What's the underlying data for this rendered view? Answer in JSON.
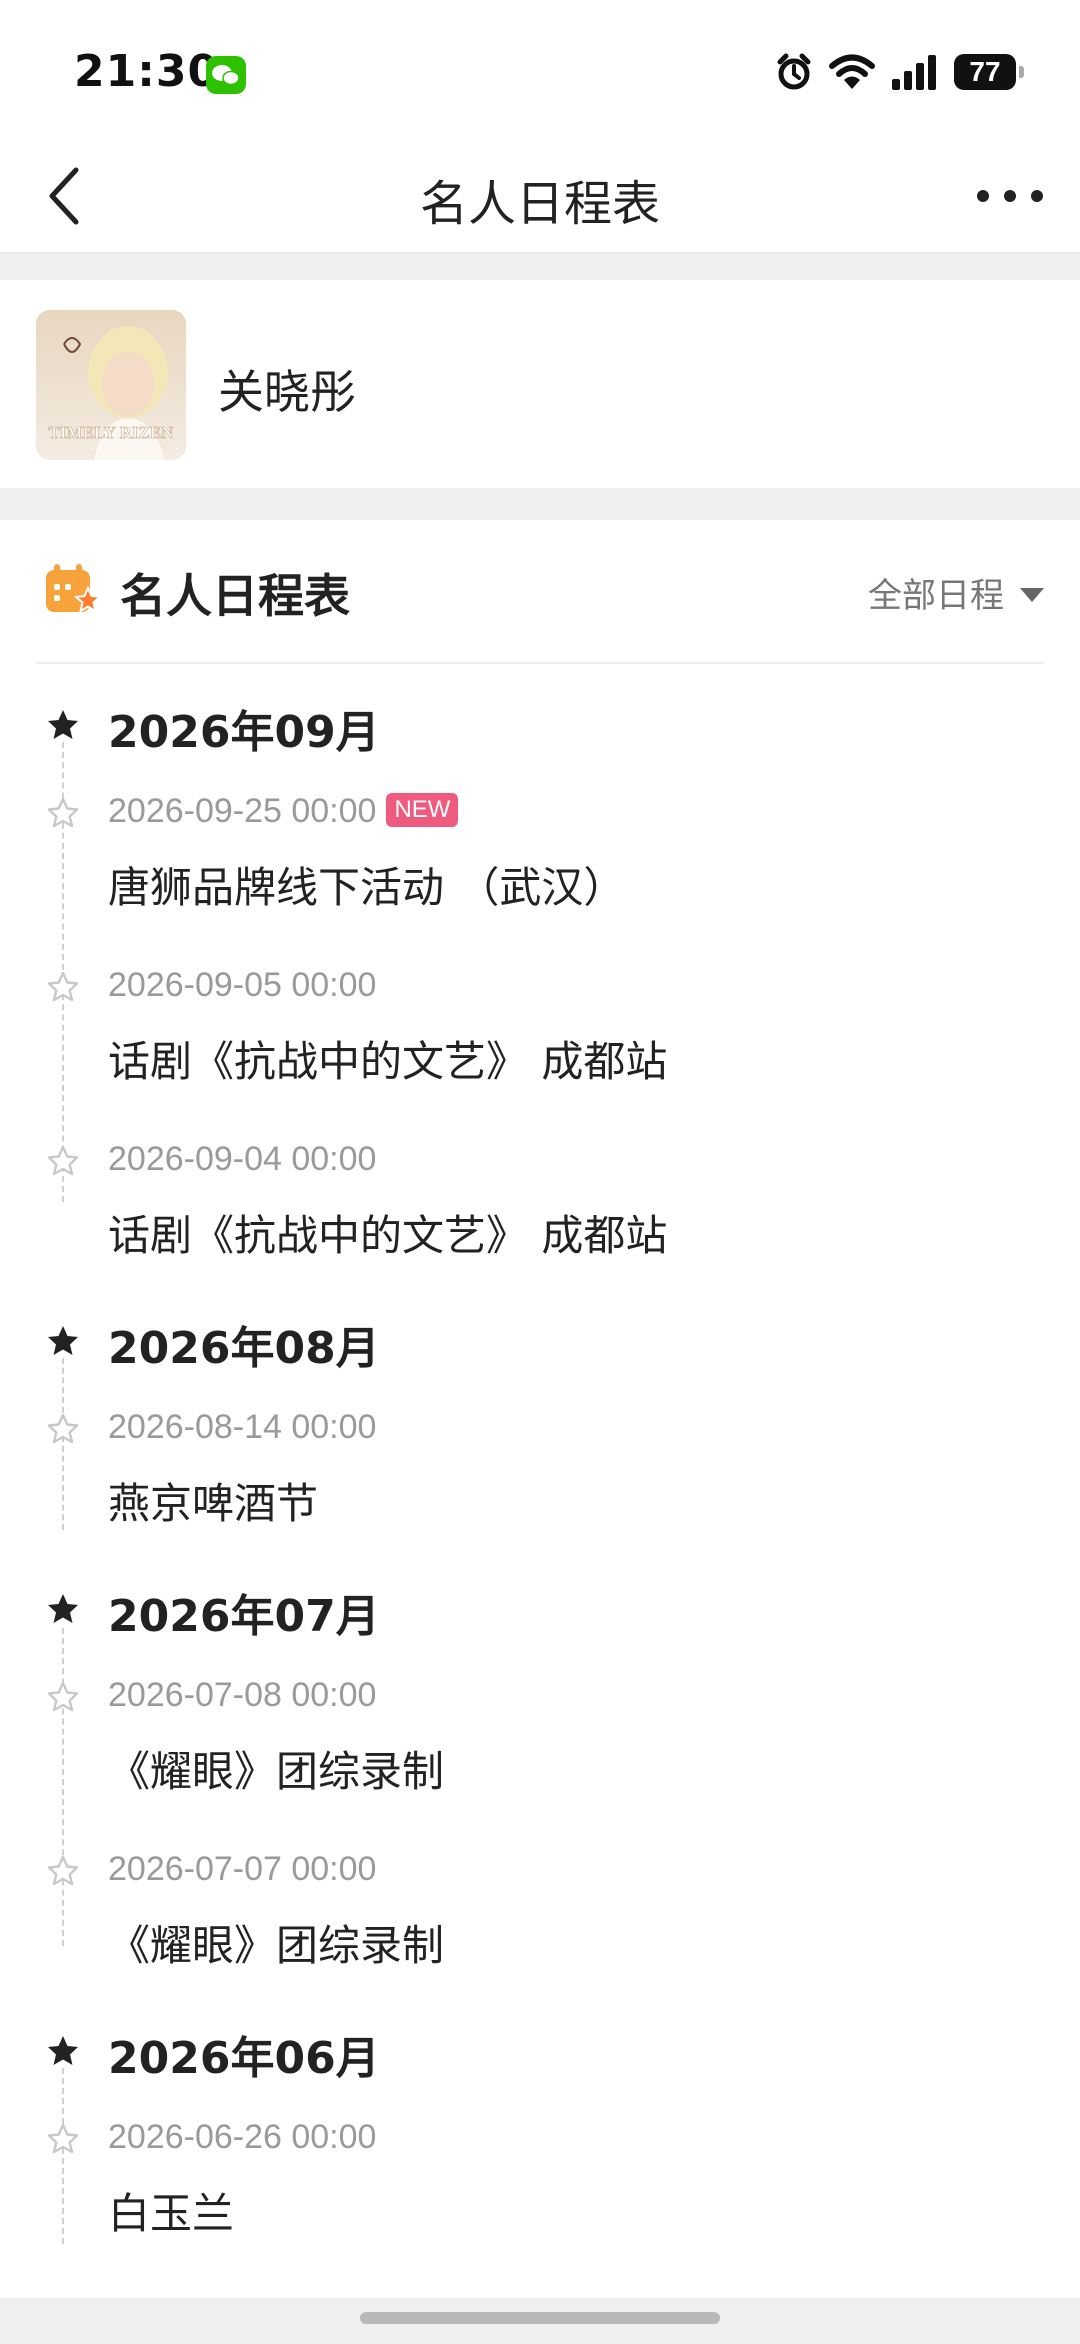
{
  "status_bar": {
    "time": "21:30",
    "battery": "77"
  },
  "nav": {
    "title": "名人日程表"
  },
  "celebrity": {
    "name": "关晓彤",
    "avatar_text": "TIMELY RIZEN"
  },
  "section": {
    "title": "名人日程表",
    "filter_label": "全部日程"
  },
  "new_badge": "NEW",
  "schedule": [
    {
      "month": "2026年09月",
      "events": [
        {
          "date": "2026-09-25 00:00",
          "title": "唐狮品牌线下活动 （武汉）",
          "is_new": true
        },
        {
          "date": "2026-09-05 00:00",
          "title": "话剧《抗战中的文艺》 成都站"
        },
        {
          "date": "2026-09-04 00:00",
          "title": "话剧《抗战中的文艺》 成都站"
        }
      ]
    },
    {
      "month": "2026年08月",
      "events": [
        {
          "date": "2026-08-14 00:00",
          "title": "燕京啤酒节"
        }
      ]
    },
    {
      "month": "2026年07月",
      "events": [
        {
          "date": "2026-07-08 00:00",
          "title": "《耀眼》团综录制"
        },
        {
          "date": "2026-07-07 00:00",
          "title": "《耀眼》团综录制"
        }
      ]
    },
    {
      "month": "2026年06月",
      "events": [
        {
          "date": "2026-06-26 00:00",
          "title": "白玉兰"
        }
      ]
    }
  ],
  "colors": {
    "new_badge": "#ef5a7f",
    "wechat": "#2dc100",
    "section_icon": "#f7a23b"
  }
}
